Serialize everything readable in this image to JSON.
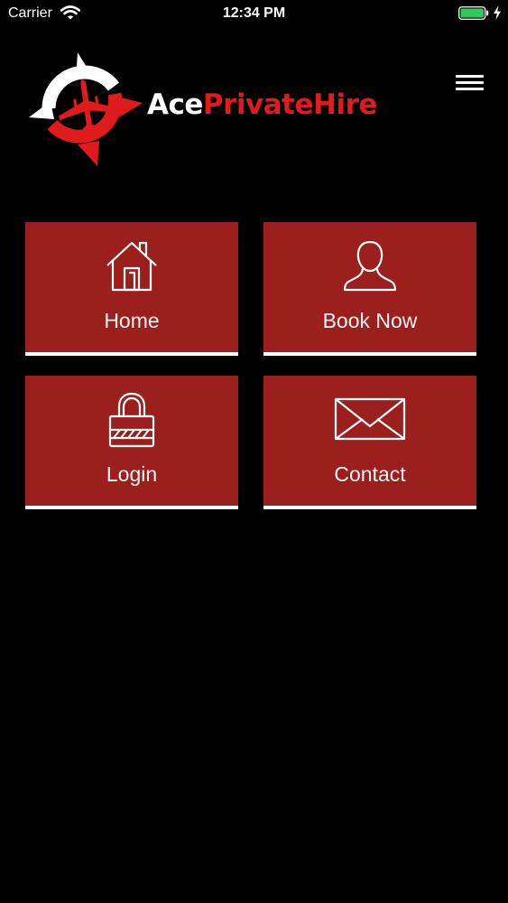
{
  "status_bar": {
    "carrier": "Carrier",
    "time": "12:34 PM",
    "battery_color": "#34c759"
  },
  "header": {
    "logo_text_ace": "Ace",
    "logo_text_rest": "PrivateHire",
    "logo_icon": "compass-plane-logo",
    "menu_icon": "hamburger-icon"
  },
  "colors": {
    "background": "#000000",
    "tile": "#9b1f1c",
    "brand_red": "#e01b1b",
    "accent_white": "#ffffff"
  },
  "tiles": [
    {
      "label": "Home",
      "icon": "house-icon"
    },
    {
      "label": "Book Now",
      "icon": "person-icon"
    },
    {
      "label": "Login",
      "icon": "padlock-icon"
    },
    {
      "label": "Contact",
      "icon": "envelope-icon"
    }
  ]
}
